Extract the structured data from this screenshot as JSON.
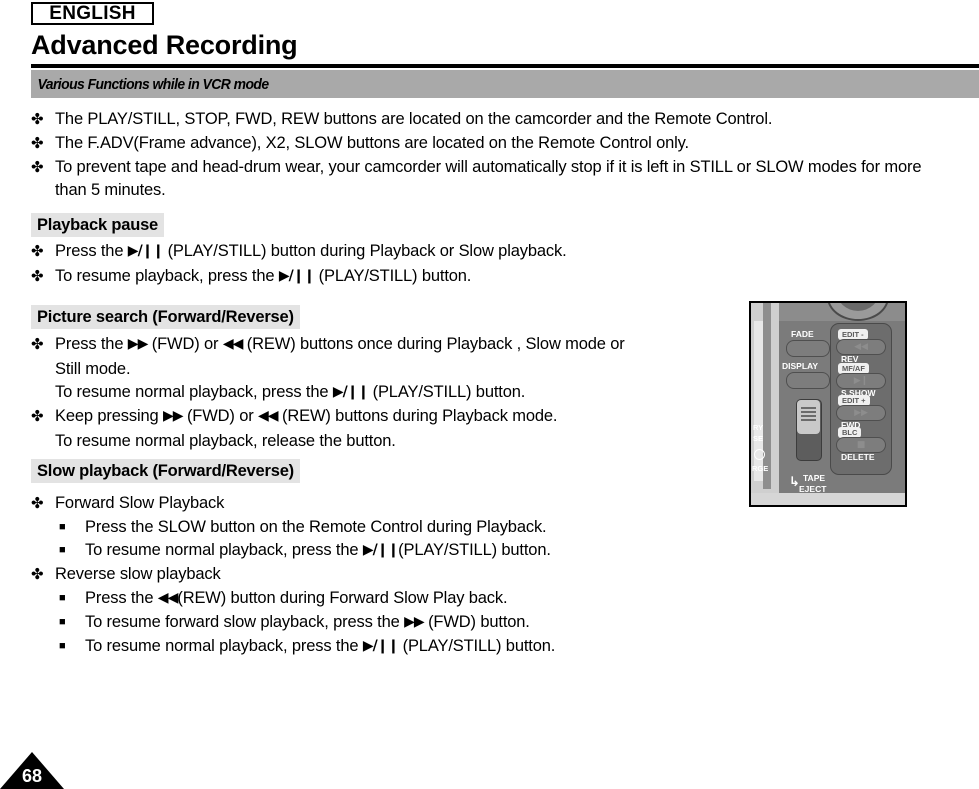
{
  "header": {
    "language_badge": "ENGLISH",
    "title": "Advanced Recording",
    "section_bar": "Various Functions while in VCR mode"
  },
  "symbols": {
    "bullet_clover": "✤",
    "bullet_square": "■",
    "play_still": "▶/❙❙",
    "fwd": "▶▶",
    "rew": "◀◀"
  },
  "intro_bullets": [
    "The PLAY/STILL, STOP, FWD, REW buttons are located on the camcorder and the Remote Control.",
    "The F.ADV(Frame advance), X2, SLOW buttons are located on the Remote Control only.",
    "To prevent tape and head-drum wear, your camcorder will automatically stop if it is left in STILL or SLOW modes for more than 5 minutes."
  ],
  "sections": [
    {
      "heading": "Playback pause",
      "lines": [
        {
          "bullet": "clover",
          "parts": [
            "Press the ",
            "SYM_PLAY",
            " (PLAY/STILL) button during Playback or Slow playback."
          ]
        },
        {
          "bullet": "clover",
          "parts": [
            "To resume playback, press the ",
            "SYM_PLAY",
            " (PLAY/STILL) button."
          ]
        }
      ]
    },
    {
      "heading": "Picture search (Forward/Reverse)",
      "lines": [
        {
          "bullet": "clover",
          "parts": [
            "Press the ",
            "SYM_FWD",
            " (FWD) or ",
            "SYM_REW",
            " (REW) buttons once during Playback , Slow mode or"
          ]
        },
        {
          "bullet": "none",
          "parts": [
            "Still mode."
          ]
        },
        {
          "bullet": "none",
          "parts": [
            "To resume normal playback, press the ",
            "SYM_PLAY",
            " (PLAY/STILL) button."
          ]
        },
        {
          "bullet": "clover",
          "parts": [
            "Keep pressing ",
            "SYM_FWD",
            " (FWD) or ",
            "SYM_REW",
            " (REW) buttons during Playback mode."
          ]
        },
        {
          "bullet": "none",
          "parts": [
            "To resume normal playback, release the button."
          ]
        }
      ]
    },
    {
      "heading": "Slow playback (Forward/Reverse)",
      "lines": [
        {
          "bullet": "clover",
          "parts": [
            "Forward Slow Playback"
          ]
        },
        {
          "bullet": "square",
          "parts": [
            "Press the SLOW button on the Remote Control during Playback."
          ]
        },
        {
          "bullet": "square",
          "parts": [
            "To resume normal playback, press the ",
            "SYM_PLAY",
            "(PLAY/STILL) button."
          ]
        },
        {
          "bullet": "clover",
          "parts": [
            "Reverse slow playback"
          ]
        },
        {
          "bullet": "square",
          "parts": [
            "Press the ",
            "SYM_REW",
            "(REW) button during Forward Slow Play back."
          ]
        },
        {
          "bullet": "square",
          "parts": [
            "To resume forward slow playback, press the ",
            "SYM_FWD",
            " (FWD) button."
          ]
        },
        {
          "bullet": "square",
          "parts": [
            "To resume normal playback, press the ",
            "SYM_PLAY",
            " (PLAY/STILL) button."
          ]
        }
      ]
    }
  ],
  "figure": {
    "name": "camcorder-side-panel",
    "labels": {
      "fade": "FADE",
      "display": "DISPLAY",
      "tape_eject_line1": "TAPE",
      "tape_eject_line2": "EJECT",
      "battery_release_line1": "RY",
      "battery_release_line2": "SE",
      "charge": "RGE"
    },
    "buttons": [
      {
        "chip": "EDIT -",
        "label": "REV"
      },
      {
        "chip": "MF/AF",
        "label": "S.SHOW"
      },
      {
        "chip": "EDIT +",
        "label": "FWD"
      },
      {
        "chip": "BLC",
        "label": "DELETE"
      }
    ]
  },
  "page_number": "68",
  "colors": {
    "section_bar_bg": "#a9a9a9",
    "sub_head_bg": "#e3e3e3",
    "rule": "#000000"
  }
}
